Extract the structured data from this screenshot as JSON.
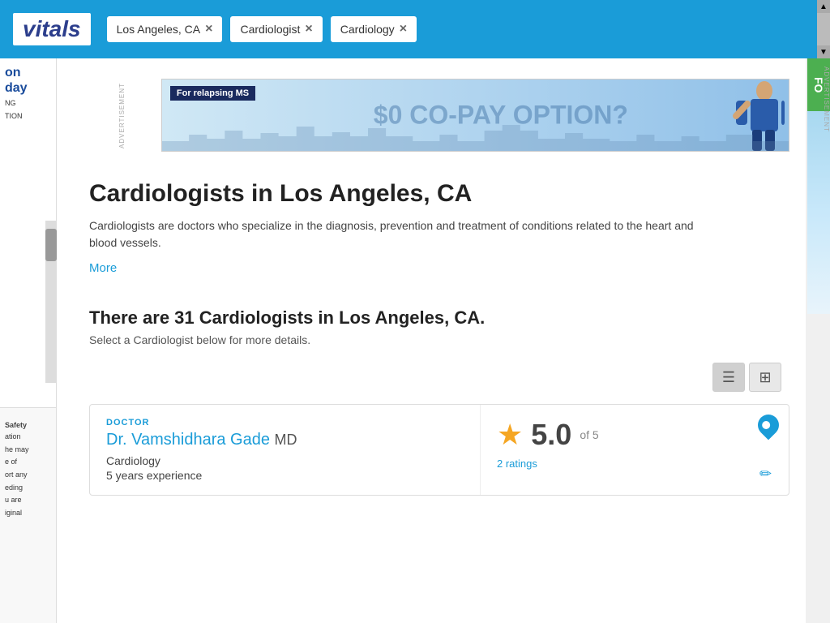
{
  "header": {
    "logo": "vitals",
    "filters": [
      {
        "label": "Los Angeles, CA",
        "id": "filter-location"
      },
      {
        "label": "Cardiologist",
        "id": "filter-specialty"
      },
      {
        "label": "Cardiology",
        "id": "filter-condition"
      }
    ]
  },
  "ad": {
    "advertisement_label": "ADVERTISEMENT",
    "ms_badge": "For relapsing MS",
    "big_text": "$0 CO-PAY OPTION?"
  },
  "page": {
    "title": "Cardiologists in Los Angeles, CA",
    "description": "Cardiologists are doctors who specialize in the diagnosis, prevention and treatment of conditions related to the heart and blood vessels.",
    "more_label": "More",
    "count_title": "There are 31 Cardiologists in Los Angeles, CA.",
    "count_subtitle": "Select a Cardiologist below for more details."
  },
  "doctor_card": {
    "label": "DOCTOR",
    "name": "Dr. Vamshidhara Gade",
    "suffix": "MD",
    "specialty": "Cardiology",
    "experience": "5 years experience",
    "rating": "5.0",
    "rating_of": "of 5",
    "ratings_count": "2 ratings"
  },
  "view_toggle": {
    "list_label": "≡",
    "grid_label": "⊞"
  },
  "left_sidebar": {
    "blue_text": "on\nday",
    "line1": "NG",
    "line2": "TION",
    "safety_label": "Safety",
    "safety_line2": "ation",
    "info_lines": [
      "he may",
      "e of",
      "ort any",
      "eding",
      "u are",
      "iginal"
    ]
  },
  "right_sidebar": {
    "advertisement_label": "ADVERTISEMENT",
    "green_text": "FO"
  }
}
